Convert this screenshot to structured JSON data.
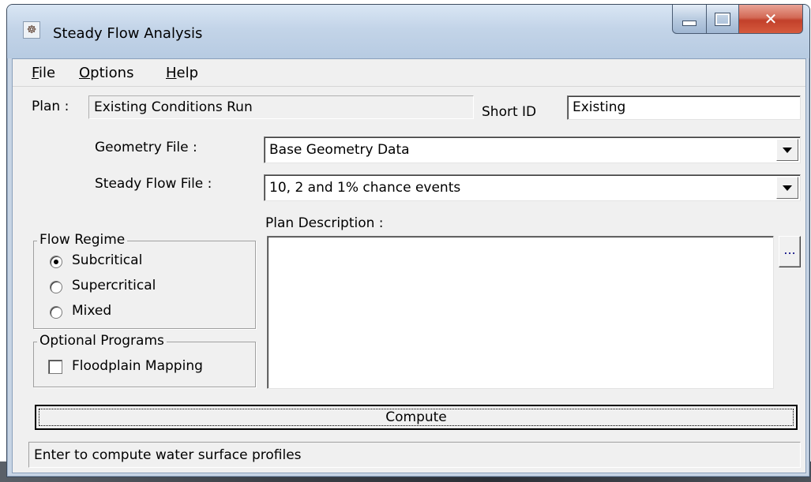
{
  "window": {
    "title": "Steady Flow Analysis"
  },
  "menu": [
    "File",
    "Options",
    "Help"
  ],
  "plan": {
    "label": "Plan :",
    "value": "Existing Conditions Run",
    "short_id_label": "Short ID",
    "short_id_value": "Existing"
  },
  "geometry": {
    "label": "Geometry File :",
    "value": "Base Geometry Data"
  },
  "steady_flow": {
    "label": "Steady Flow File :",
    "value": "10, 2 and 1% chance events"
  },
  "flow_regime": {
    "title": "Flow Regime",
    "options": [
      "Subcritical",
      "Supercritical",
      "Mixed"
    ],
    "selected": "Subcritical"
  },
  "optional_programs": {
    "title": "Optional Programs",
    "floodplain_mapping_label": "Floodplain Mapping",
    "floodplain_mapping_checked": false
  },
  "description": {
    "label": "Plan Description :",
    "value": "",
    "browse_label": "..."
  },
  "compute_label": "Compute",
  "status_text": "Enter to compute water surface profiles",
  "icons": {
    "app": "hec-ras-icon",
    "minimize": "minimize-icon",
    "maximize": "maximize-icon",
    "close": "close-icon"
  }
}
